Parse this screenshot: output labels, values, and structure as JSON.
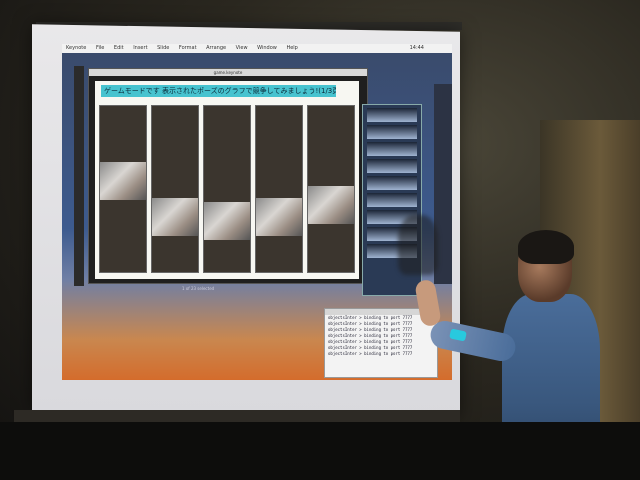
{
  "menubar": {
    "items": [
      "Keynote",
      "File",
      "Edit",
      "Insert",
      "Slide",
      "Format",
      "Arrange",
      "View",
      "Window",
      "Help"
    ],
    "clock": "14:44"
  },
  "app_window": {
    "title": "game.keynote"
  },
  "caption": "ゲームモードです 表示されたポーズのグラフで競争してみましょう!(1/3頁)",
  "status_text": "1 of 23 selected",
  "log": {
    "lines": [
      "objectsInter > binding to port 7777",
      "objectsInter > binding to port 7777",
      "objectsInter > binding to port 7777",
      "objectsInter > binding to port 7777",
      "objectsInter > binding to port 7777",
      "objectsInter > binding to port 7777",
      "objectsInter > binding to port 7777"
    ]
  },
  "colors": {
    "caption_bg": "#47c3cf",
    "wristband": "#28c9de",
    "desktop_top": "#3d5b8f",
    "desktop_bottom": "#d46c2c"
  }
}
